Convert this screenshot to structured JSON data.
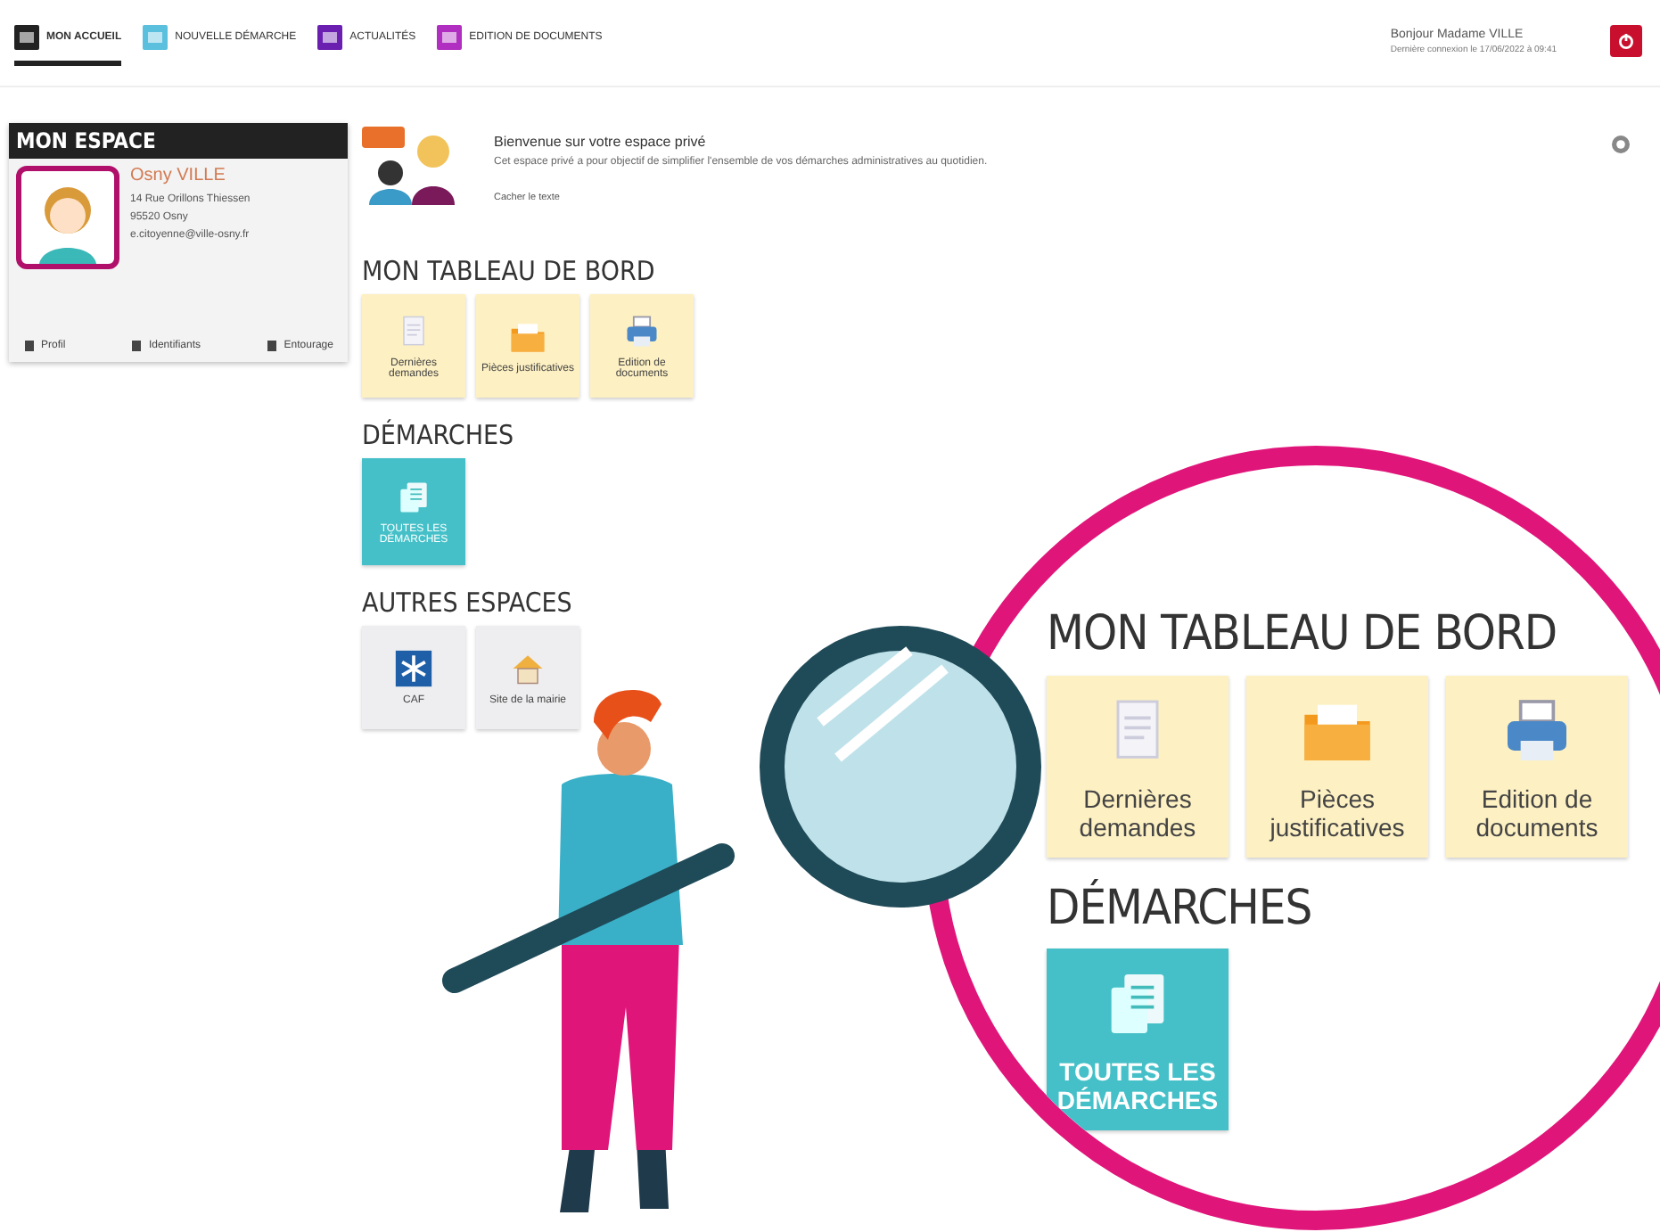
{
  "nav": [
    {
      "label": "MON ACCUEIL",
      "selected": true,
      "color": "#222222"
    },
    {
      "label": "NOUVELLE DÉMARCHE",
      "selected": false,
      "color": "#5bc0de"
    },
    {
      "label": "ACTUALITÉS",
      "selected": false,
      "color": "#6a1fb0"
    },
    {
      "label": "EDITION DE DOCUMENTS",
      "selected": false,
      "color": "#b02fc0"
    }
  ],
  "user": {
    "greeting": "Bonjour Madame VILLE",
    "last_login": "Dernière connexion le 17/06/2022 à 09:41"
  },
  "profile": {
    "title": "MON ESPACE",
    "name": "Osny VILLE",
    "address_lines": [
      "14 Rue Orillons Thiessen",
      "95520 Osny",
      "e.citoyenne@ville-osny.fr"
    ],
    "buttons": [
      "Profil",
      "Identifiants",
      "Entourage"
    ]
  },
  "welcome": {
    "title": "Bienvenue sur votre espace privé",
    "text": "Cet espace privé a pour objectif de simplifier l'ensemble de vos démarches administratives au quotidien.",
    "link": "Cacher le texte"
  },
  "sections": [
    {
      "title": "MON TABLEAU DE BORD",
      "tiles": [
        {
          "label": "Dernières demandes",
          "kind": "dashboard"
        },
        {
          "label": "Pièces justificatives",
          "kind": "dashboard"
        },
        {
          "label": "Edition de documents",
          "kind": "dashboard"
        }
      ]
    },
    {
      "title": "DÉMARCHES",
      "tiles": [
        {
          "label": "TOUTES LES DÉMARCHES",
          "kind": "action"
        }
      ]
    },
    {
      "title": "AUTRES ESPACES",
      "tiles": [
        {
          "label": "CAF",
          "kind": "external"
        },
        {
          "label": "Site de la mairie",
          "kind": "external"
        }
      ]
    }
  ],
  "magnified": [
    {
      "title": "MON TABLEAU DE BORD",
      "tiles": [
        {
          "label": "Dernières demandes",
          "kind": "dashboard"
        },
        {
          "label": "Pièces justificatives",
          "kind": "dashboard"
        },
        {
          "label": "Edition de documents",
          "kind": "dashboard"
        }
      ]
    },
    {
      "title": "DÉMARCHES",
      "tiles": [
        {
          "label": "TOUTES LES DÉMARCHES",
          "kind": "action"
        }
      ]
    }
  ]
}
